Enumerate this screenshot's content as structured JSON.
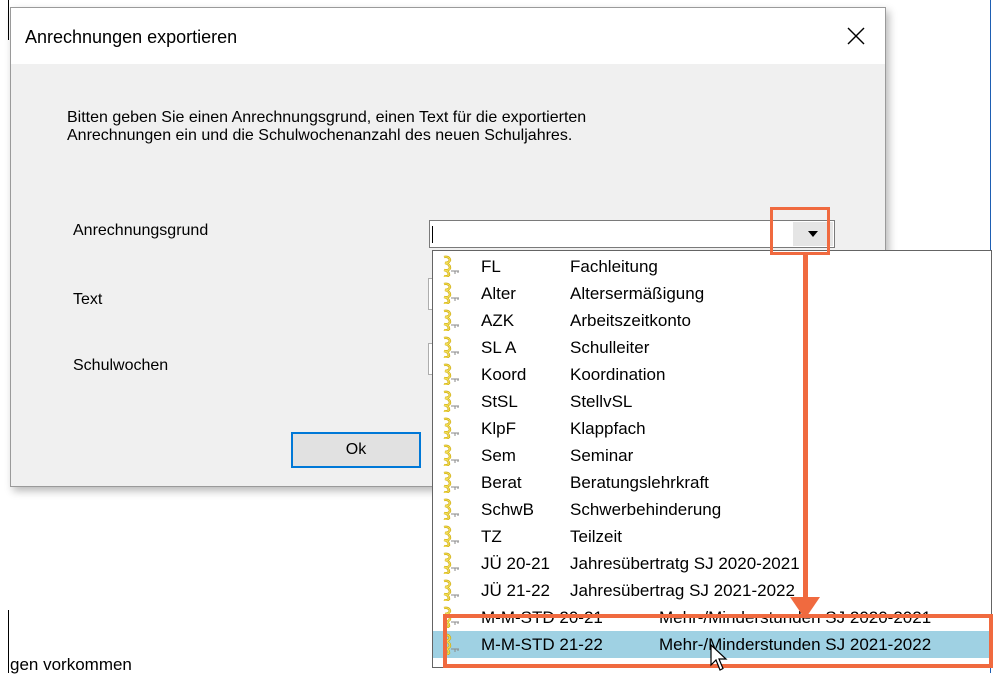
{
  "dialog": {
    "title": "Anrechnungen exportieren",
    "instructions": "Bitten geben Sie einen Anrechnungsgrund, einen Text für die exportierten\nAnrechnungen ein und die Schulwochenanzahl des neuen Schuljahres.",
    "labels": {
      "grund": "Anrechnungsgrund",
      "text": "Text",
      "schulwochen": "Schulwochen"
    },
    "grund_value": "",
    "ok_label": "Ok"
  },
  "dropdown": {
    "items": [
      {
        "code": "FL",
        "desc": "Fachleitung"
      },
      {
        "code": "Alter",
        "desc": "Altersermäßigung"
      },
      {
        "code": "AZK",
        "desc": "Arbeitszeitkonto"
      },
      {
        "code": "SL A",
        "desc": "Schulleiter"
      },
      {
        "code": "Koord",
        "desc": "Koordination"
      },
      {
        "code": "StSL",
        "desc": "StellvSL"
      },
      {
        "code": "KlpF",
        "desc": "Klappfach"
      },
      {
        "code": "Sem",
        "desc": "Seminar"
      },
      {
        "code": "Berat",
        "desc": "Beratungslehrkraft"
      },
      {
        "code": "SchwB",
        "desc": "Schwerbehinderung"
      },
      {
        "code": "TZ",
        "desc": "Teilzeit"
      },
      {
        "code": "JÜ 20-21",
        "desc": "Jahresübertratg SJ 2020-2021"
      },
      {
        "code": "JÜ 21-22",
        "desc": "Jahresübertrag SJ 2021-2022"
      },
      {
        "code": "M-M-STD 20-21",
        "desc": "Mehr-/Minderstunden SJ 2020-2021"
      },
      {
        "code": "M-M-STD 21-22",
        "desc": "Mehr-/Minderstunden SJ 2021-2022"
      }
    ],
    "selected_index": 14
  },
  "background": {
    "partial_text": "gen vorkommen"
  },
  "colors": {
    "annotation": "#f06a3f",
    "selection": "#9fd1e3",
    "accent": "#0078d7"
  },
  "icons": {
    "list_item": "key-icon",
    "close": "close-icon",
    "dropdown": "chevron-down-icon"
  }
}
